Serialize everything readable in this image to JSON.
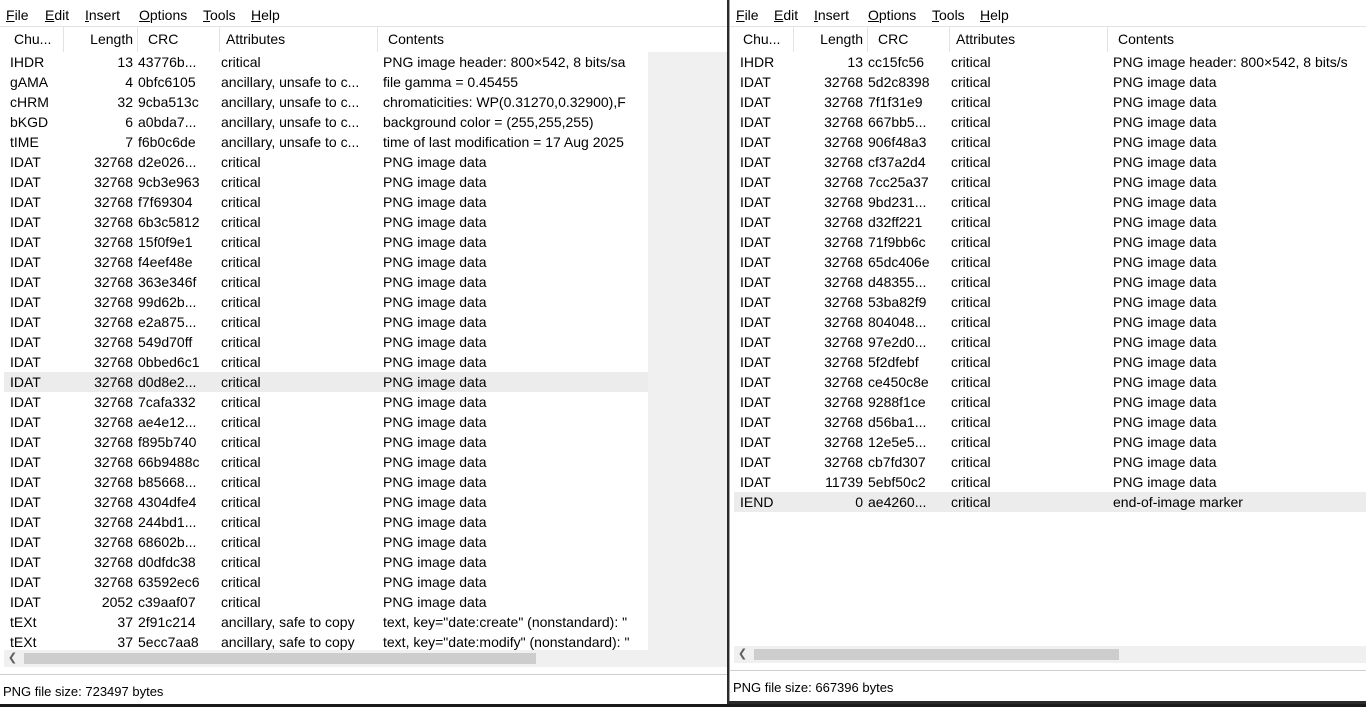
{
  "menu": {
    "file": "File",
    "edit": "Edit",
    "insert": "Insert",
    "options": "Options",
    "tools": "Tools",
    "help": "Help"
  },
  "columns": {
    "chunk": "Chu...",
    "length": "Length",
    "crc": "CRC",
    "attributes": "Attributes",
    "contents": "Contents"
  },
  "left": {
    "status": "PNG file size: 723497 bytes",
    "selected_row": 16,
    "rows": [
      [
        "IHDR",
        "13",
        "43776b...",
        "critical",
        "PNG image header: 800×542, 8 bits/sa"
      ],
      [
        "gAMA",
        "4",
        "0bfc6105",
        "ancillary, unsafe to c...",
        "file gamma = 0.45455"
      ],
      [
        "cHRM",
        "32",
        "9cba513c",
        "ancillary, unsafe to c...",
        "chromaticities: WP(0.31270,0.32900),F"
      ],
      [
        "bKGD",
        "6",
        "a0bda7...",
        "ancillary, unsafe to c...",
        "background color = (255,255,255)"
      ],
      [
        "tIME",
        "7",
        "f6b0c6de",
        "ancillary, unsafe to c...",
        "time of last modification = 17 Aug 2025"
      ],
      [
        "IDAT",
        "32768",
        "d2e026...",
        "critical",
        "PNG image data"
      ],
      [
        "IDAT",
        "32768",
        "9cb3e963",
        "critical",
        "PNG image data"
      ],
      [
        "IDAT",
        "32768",
        "f7f69304",
        "critical",
        "PNG image data"
      ],
      [
        "IDAT",
        "32768",
        "6b3c5812",
        "critical",
        "PNG image data"
      ],
      [
        "IDAT",
        "32768",
        "15f0f9e1",
        "critical",
        "PNG image data"
      ],
      [
        "IDAT",
        "32768",
        "f4eef48e",
        "critical",
        "PNG image data"
      ],
      [
        "IDAT",
        "32768",
        "363e346f",
        "critical",
        "PNG image data"
      ],
      [
        "IDAT",
        "32768",
        "99d62b...",
        "critical",
        "PNG image data"
      ],
      [
        "IDAT",
        "32768",
        "e2a875...",
        "critical",
        "PNG image data"
      ],
      [
        "IDAT",
        "32768",
        "549d70ff",
        "critical",
        "PNG image data"
      ],
      [
        "IDAT",
        "32768",
        "0bbed6c1",
        "critical",
        "PNG image data"
      ],
      [
        "IDAT",
        "32768",
        "d0d8e2...",
        "critical",
        "PNG image data"
      ],
      [
        "IDAT",
        "32768",
        "7cafa332",
        "critical",
        "PNG image data"
      ],
      [
        "IDAT",
        "32768",
        "ae4e12...",
        "critical",
        "PNG image data"
      ],
      [
        "IDAT",
        "32768",
        "f895b740",
        "critical",
        "PNG image data"
      ],
      [
        "IDAT",
        "32768",
        "66b9488c",
        "critical",
        "PNG image data"
      ],
      [
        "IDAT",
        "32768",
        "b85668...",
        "critical",
        "PNG image data"
      ],
      [
        "IDAT",
        "32768",
        "4304dfe4",
        "critical",
        "PNG image data"
      ],
      [
        "IDAT",
        "32768",
        "244bd1...",
        "critical",
        "PNG image data"
      ],
      [
        "IDAT",
        "32768",
        "68602b...",
        "critical",
        "PNG image data"
      ],
      [
        "IDAT",
        "32768",
        "d0dfdc38",
        "critical",
        "PNG image data"
      ],
      [
        "IDAT",
        "32768",
        "63592ec6",
        "critical",
        "PNG image data"
      ],
      [
        "IDAT",
        "2052",
        "c39aaf07",
        "critical",
        "PNG image data"
      ],
      [
        "tEXt",
        "37",
        "2f91c214",
        "ancillary, safe to copy",
        "text, key=\"date:create\" (nonstandard): \""
      ],
      [
        "tEXt",
        "37",
        "5ecc7aa8",
        "ancillary, safe to copy",
        "text, key=\"date:modify\" (nonstandard): \""
      ]
    ]
  },
  "right": {
    "status": "PNG file size: 667396 bytes",
    "selected_row": 22,
    "rows": [
      [
        "IHDR",
        "13",
        "cc15fc56",
        "critical",
        "PNG image header: 800×542, 8 bits/s"
      ],
      [
        "IDAT",
        "32768",
        "5d2c8398",
        "critical",
        "PNG image data"
      ],
      [
        "IDAT",
        "32768",
        "7f1f31e9",
        "critical",
        "PNG image data"
      ],
      [
        "IDAT",
        "32768",
        "667bb5...",
        "critical",
        "PNG image data"
      ],
      [
        "IDAT",
        "32768",
        "906f48a3",
        "critical",
        "PNG image data"
      ],
      [
        "IDAT",
        "32768",
        "cf37a2d4",
        "critical",
        "PNG image data"
      ],
      [
        "IDAT",
        "32768",
        "7cc25a37",
        "critical",
        "PNG image data"
      ],
      [
        "IDAT",
        "32768",
        "9bd231...",
        "critical",
        "PNG image data"
      ],
      [
        "IDAT",
        "32768",
        "d32ff221",
        "critical",
        "PNG image data"
      ],
      [
        "IDAT",
        "32768",
        "71f9bb6c",
        "critical",
        "PNG image data"
      ],
      [
        "IDAT",
        "32768",
        "65dc406e",
        "critical",
        "PNG image data"
      ],
      [
        "IDAT",
        "32768",
        "d48355...",
        "critical",
        "PNG image data"
      ],
      [
        "IDAT",
        "32768",
        "53ba82f9",
        "critical",
        "PNG image data"
      ],
      [
        "IDAT",
        "32768",
        "804048...",
        "critical",
        "PNG image data"
      ],
      [
        "IDAT",
        "32768",
        "97e2d0...",
        "critical",
        "PNG image data"
      ],
      [
        "IDAT",
        "32768",
        "5f2dfebf",
        "critical",
        "PNG image data"
      ],
      [
        "IDAT",
        "32768",
        "ce450c8e",
        "critical",
        "PNG image data"
      ],
      [
        "IDAT",
        "32768",
        "9288f1ce",
        "critical",
        "PNG image data"
      ],
      [
        "IDAT",
        "32768",
        "d56ba1...",
        "critical",
        "PNG image data"
      ],
      [
        "IDAT",
        "32768",
        "12e5e5...",
        "critical",
        "PNG image data"
      ],
      [
        "IDAT",
        "32768",
        "cb7fd307",
        "critical",
        "PNG image data"
      ],
      [
        "IDAT",
        "11739",
        "5ebf50c2",
        "critical",
        "PNG image data"
      ],
      [
        "IEND",
        "0",
        "ae4260...",
        "critical",
        "end-of-image marker"
      ]
    ]
  },
  "icons": {
    "scroll_left": "chevron-left-icon"
  }
}
